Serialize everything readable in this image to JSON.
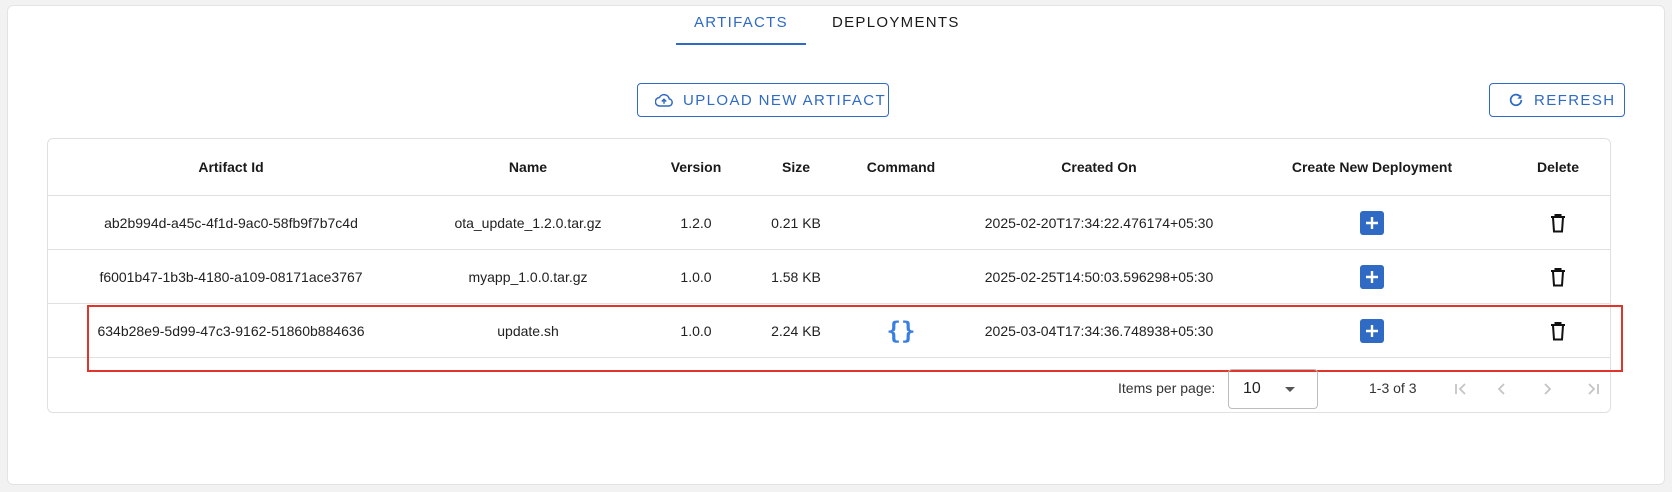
{
  "tabs": [
    {
      "label": "ARTIFACTS",
      "active": true
    },
    {
      "label": "DEPLOYMENTS",
      "active": false
    }
  ],
  "toolbar": {
    "upload_label": "UPLOAD NEW ARTIFACT",
    "refresh_label": "REFRESH"
  },
  "colors": {
    "accent": "#2f6ac4",
    "highlight": "#e0352b",
    "command_icon": "#3a7fe0"
  },
  "table": {
    "headers": [
      "Artifact Id",
      "Name",
      "Version",
      "Size",
      "Command",
      "Created On",
      "Create New Deployment",
      "Delete"
    ],
    "rows": [
      {
        "artifact_id": "ab2b994d-a45c-4f1d-9ac0-58fb9f7b7c4d",
        "name": "ota_update_1.2.0.tar.gz",
        "version": "1.2.0",
        "size": "0.21 KB",
        "command": "",
        "created_on": "2025-02-20T17:34:22.476174+05:30"
      },
      {
        "artifact_id": "f6001b47-1b3b-4180-a109-08171ace3767",
        "name": "myapp_1.0.0.tar.gz",
        "version": "1.0.0",
        "size": "1.58 KB",
        "command": "",
        "created_on": "2025-02-25T14:50:03.596298+05:30"
      },
      {
        "artifact_id": "634b28e9-5d99-47c3-9162-51860b884636",
        "name": "update.sh",
        "version": "1.0.0",
        "size": "2.24 KB",
        "command": "{}",
        "created_on": "2025-03-04T17:34:36.748938+05:30"
      }
    ]
  },
  "pagination": {
    "items_per_page_label": "Items per page:",
    "items_per_page_value": "10",
    "range_text": "1-3 of 3"
  },
  "icons": [
    "cloud-upload-icon",
    "refresh-icon",
    "plus-icon",
    "trash-icon",
    "braces-icon",
    "first-page-icon",
    "prev-page-icon",
    "next-page-icon",
    "last-page-icon"
  ]
}
